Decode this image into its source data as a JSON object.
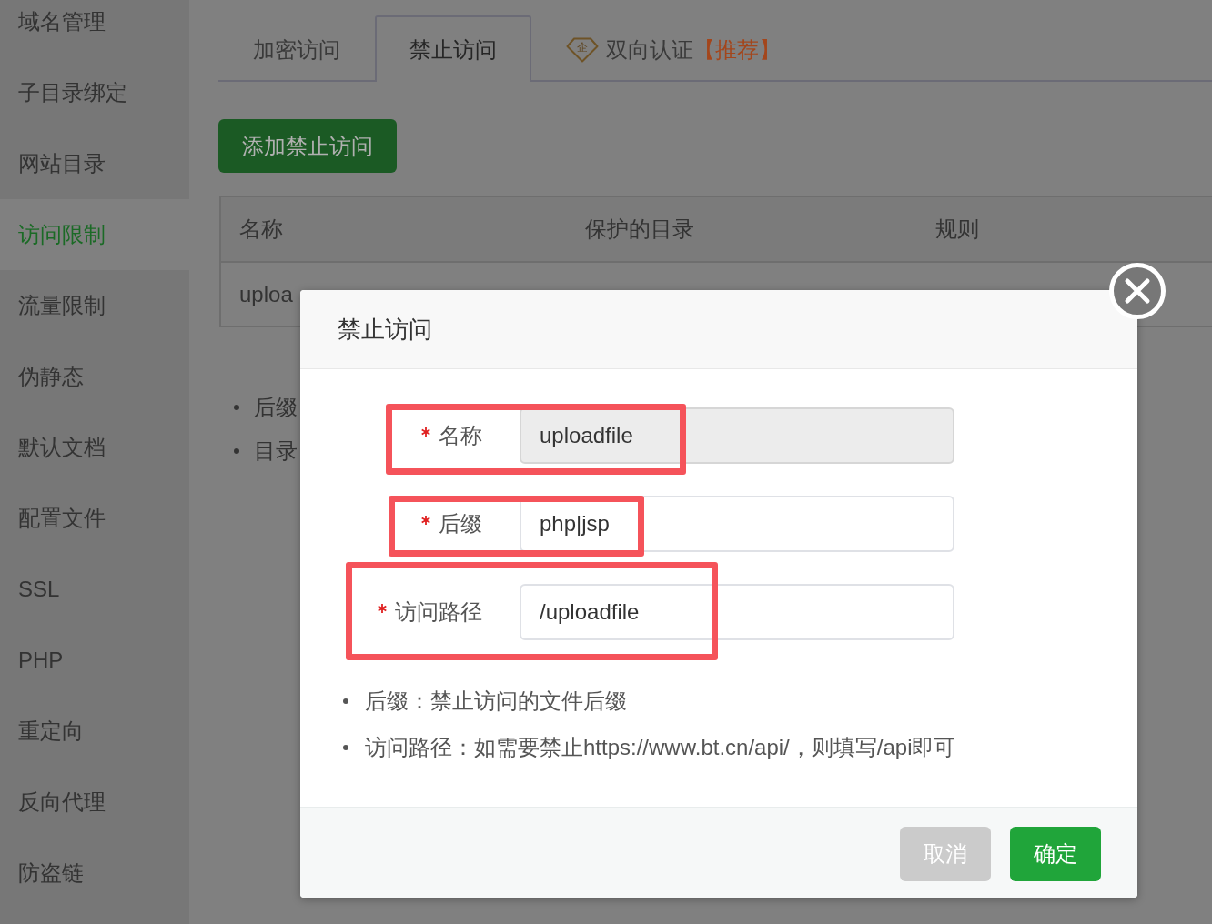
{
  "sidebar": {
    "items": [
      {
        "label": "域名管理",
        "selected": false
      },
      {
        "label": "子目录绑定",
        "selected": false
      },
      {
        "label": "网站目录",
        "selected": false
      },
      {
        "label": "访问限制",
        "selected": true
      },
      {
        "label": "流量限制",
        "selected": false
      },
      {
        "label": "伪静态",
        "selected": false
      },
      {
        "label": "默认文档",
        "selected": false
      },
      {
        "label": "配置文件",
        "selected": false
      },
      {
        "label": "SSL",
        "selected": false
      },
      {
        "label": "PHP",
        "selected": false
      },
      {
        "label": "重定向",
        "selected": false
      },
      {
        "label": "反向代理",
        "selected": false
      },
      {
        "label": "防盗链",
        "selected": false
      }
    ]
  },
  "tabs": [
    {
      "kind": "plain",
      "label": "加密访问",
      "selected": false
    },
    {
      "kind": "plain",
      "label": "禁止访问",
      "selected": true
    },
    {
      "kind": "premium",
      "icon_text": "企",
      "label": "双向认证",
      "tag": "【推荐】",
      "selected": false
    }
  ],
  "add_button": "添加禁止访问",
  "table": {
    "columns": [
      "名称",
      "保护的目录",
      "规则"
    ],
    "rows": [
      [
        "uploa"
      ]
    ]
  },
  "notes": [
    "后缀",
    "目录"
  ],
  "dialog": {
    "title": "禁止访问",
    "fields": [
      {
        "label": "名称",
        "value": "uploadfile",
        "required": true,
        "readonly": true,
        "highlighted": true
      },
      {
        "label": "后缀",
        "value": "php|jsp",
        "required": true,
        "readonly": false,
        "highlighted": true
      },
      {
        "label": "访问路径",
        "value": "/uploadfile",
        "required": true,
        "readonly": false,
        "highlighted": true
      }
    ],
    "notes": [
      "后缀：禁止访问的文件后缀",
      "访问路径：如需要禁止https://www.bt.cn/api/，则填写/api即可"
    ],
    "buttons": [
      {
        "kind": "cancel",
        "label": "取消"
      },
      {
        "kind": "primary",
        "label": "确定"
      }
    ]
  }
}
